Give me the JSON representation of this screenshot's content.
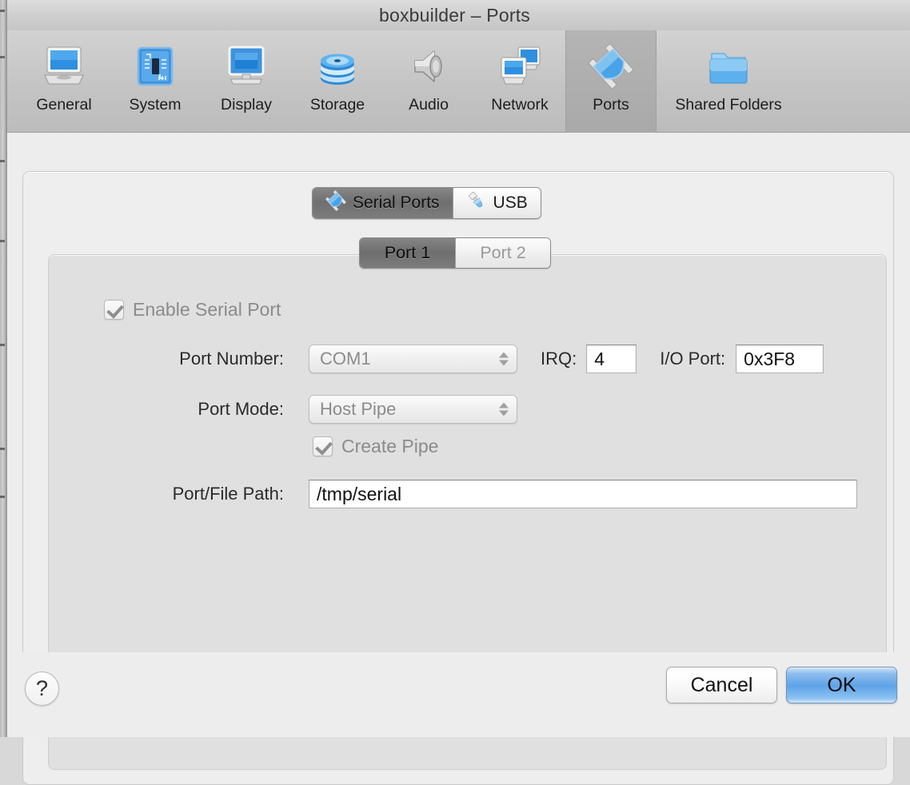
{
  "window": {
    "title": "boxbuilder – Ports"
  },
  "toolbar": {
    "items": [
      {
        "label": "General",
        "icon": "monitor-icon",
        "selected": false
      },
      {
        "label": "System",
        "icon": "motherboard-icon",
        "selected": false
      },
      {
        "label": "Display",
        "icon": "display-icon",
        "selected": false
      },
      {
        "label": "Storage",
        "icon": "disk-stack-icon",
        "selected": false
      },
      {
        "label": "Audio",
        "icon": "speaker-icon",
        "selected": false
      },
      {
        "label": "Network",
        "icon": "network-icon",
        "selected": false
      },
      {
        "label": "Ports",
        "icon": "ports-plug-icon",
        "selected": true
      },
      {
        "label": "Shared Folders",
        "icon": "folder-icon",
        "selected": false
      }
    ]
  },
  "section_tabs": {
    "serial": {
      "label": "Serial Ports",
      "icon": "ports-plug-icon",
      "selected": true
    },
    "usb": {
      "label": "USB",
      "icon": "usb-plug-icon",
      "selected": false
    }
  },
  "port_tabs": [
    {
      "label": "Port 1",
      "selected": true
    },
    {
      "label": "Port 2",
      "selected": false
    }
  ],
  "form": {
    "enable_serial_port": {
      "label": "Enable Serial Port",
      "checked": true
    },
    "port_number": {
      "label": "Port Number:",
      "value": "COM1"
    },
    "irq": {
      "label": "IRQ:",
      "value": "4"
    },
    "io_port": {
      "label": "I/O Port:",
      "value": "0x3F8"
    },
    "port_mode": {
      "label": "Port Mode:",
      "value": "Host Pipe"
    },
    "create_pipe": {
      "label": "Create Pipe",
      "checked": true
    },
    "port_file_path": {
      "label": "Port/File Path:",
      "value": "/tmp/serial"
    }
  },
  "footer": {
    "help": "?",
    "cancel": "Cancel",
    "ok": "OK"
  },
  "colors": {
    "accent_blue": "#5fa3e8",
    "toolbar_selected": "#ababab",
    "panel": "#e0e0e0",
    "window": "#ededed"
  }
}
